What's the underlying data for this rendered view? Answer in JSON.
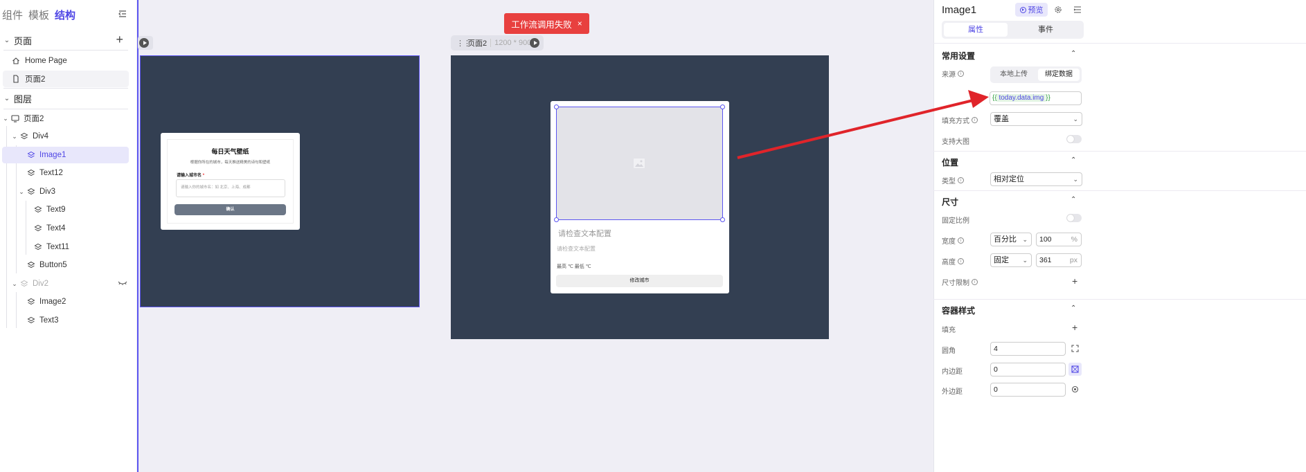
{
  "left": {
    "tabs": [
      "组件",
      "模板",
      "结构"
    ],
    "pages_title": "页面",
    "pages": [
      "Home Page",
      "页面2"
    ],
    "layers_title": "图层",
    "tree": {
      "root": "页面2",
      "div4": "Div4",
      "image1": "Image1",
      "text12": "Text12",
      "div3": "Div3",
      "text9": "Text9",
      "text4": "Text4",
      "text11": "Text11",
      "button5": "Button5",
      "div2": "Div2",
      "image2": "Image2",
      "text3": "Text3"
    }
  },
  "toast": {
    "text": "工作流调用失败",
    "close": "×"
  },
  "canvas": {
    "frame2_name": "页面2",
    "frame2_size": "1200 * 900",
    "weather": {
      "title": "每日天气壁纸",
      "subtitle": "根据你所在的城市，每天推送精美的诗句和壁纸",
      "label": "请输入城市名",
      "required": "*",
      "placeholder": "请输入你的城市名：如 北京、上海、成都",
      "button": "确认"
    },
    "card2": {
      "title": "请检查文本配置",
      "subtitle": "请检查文本配置",
      "temp": "最高 ℃  最低 ℃",
      "button": "修改城市"
    }
  },
  "right": {
    "title": "Image1",
    "preview": "预览",
    "tabs": [
      "属性",
      "事件"
    ],
    "common_title": "常用设置",
    "source_label": "来源",
    "source_options": [
      "本地上传",
      "绑定数据"
    ],
    "bind_open": "{{",
    "bind_value": " today.data.img ",
    "bind_close": "}}",
    "fill_label": "填充方式",
    "fill_value": "覆盖",
    "zoom_label": "支持大图",
    "position_title": "位置",
    "type_label": "类型",
    "type_value": "相对定位",
    "size_title": "尺寸",
    "ratio_label": "固定比例",
    "width_label": "宽度",
    "width_mode": "百分比",
    "width_value": "100",
    "width_unit": "%",
    "height_label": "高度",
    "height_mode": "固定",
    "height_value": "361",
    "height_unit": "px",
    "limit_label": "尺寸限制",
    "container_title": "容器样式",
    "fill2_label": "填充",
    "radius_label": "圆角",
    "radius_value": "4",
    "padding_label": "内边距",
    "padding_value": "0",
    "margin_label": "外边距",
    "margin_value": "0"
  },
  "colors": {
    "accent": "#4f46e5",
    "canvas": "#333f52",
    "toast": "#e8403f",
    "arrow": "#e0242a"
  }
}
